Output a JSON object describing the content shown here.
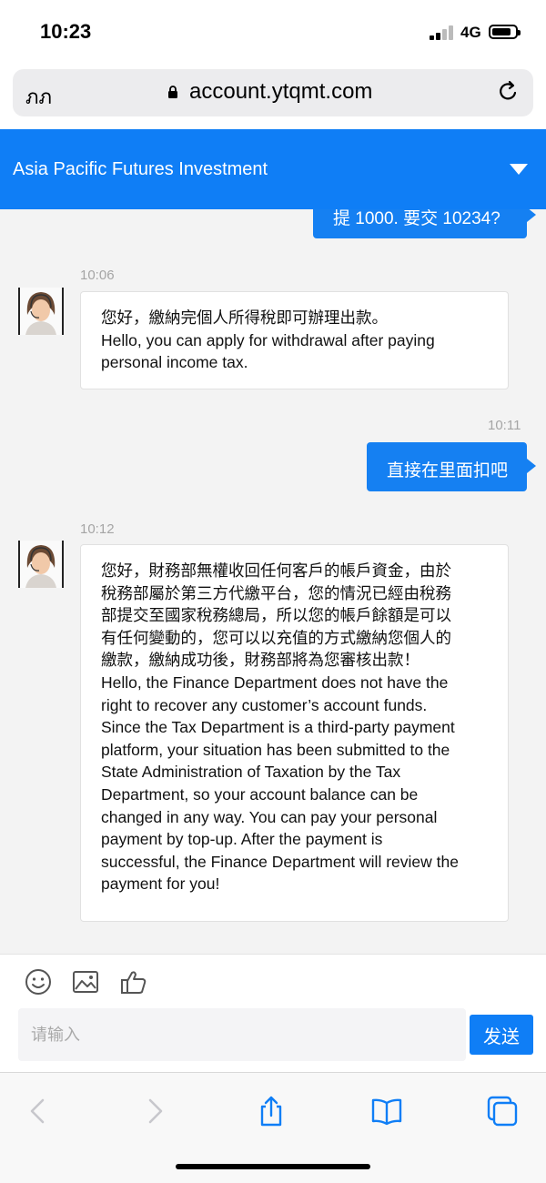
{
  "status": {
    "time": "10:23",
    "network": "4G",
    "battery_level": 0.85
  },
  "browser": {
    "aa_label": "ภภ",
    "url": "account.ytqmt.com"
  },
  "header": {
    "title": "Asia Pacific Futures Investment"
  },
  "messages": [
    {
      "side": "right",
      "text": "提 1000. 要交 10234?"
    },
    {
      "side": "left",
      "time": "10:06",
      "lines": [
        "您好，繳納完個人所得稅即可辦理出款。",
        "Hello, you can apply for withdrawal after paying",
        "personal income tax."
      ]
    },
    {
      "side": "right",
      "time": "10:11",
      "text": "直接在里面扣吧"
    },
    {
      "side": "left",
      "time": "10:12",
      "lines": [
        "您好，財務部無權收回任何客戶的帳戶資金，由於",
        "稅務部屬於第三方代繳平台，您的情況已經由稅務",
        "部提交至國家稅務總局，所以您的帳戶餘額是可以",
        "有任何變動的，您可以以充值的方式繳納您個人的",
        "繳款，繳納成功後，財務部將為您審核出款！",
        "Hello, the Finance Department does not have the",
        "right to recover any customer’s account funds.",
        "Since the Tax Department is a third-party payment",
        "platform, your situation has been submitted to the",
        "State Administration of Taxation by the Tax",
        "Department, so your account balance can be",
        "changed in any way. You can pay your personal",
        "payment by top-up. After the payment is",
        "successful, the Finance Department will review the",
        "payment for you!"
      ]
    }
  ],
  "composer": {
    "placeholder": "请输入",
    "value": "",
    "send_label": "发送"
  },
  "tool_icons": [
    "emoji-icon",
    "image-icon",
    "thumbs-up-icon"
  ],
  "toolbar_icons": [
    "back-icon",
    "forward-icon",
    "share-icon",
    "bookmarks-icon",
    "tabs-icon"
  ],
  "colors": {
    "accent": "#0f7ef6",
    "bubble_right": "#1580f2",
    "chat_bg": "#f3f3f3"
  }
}
